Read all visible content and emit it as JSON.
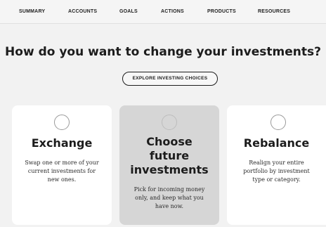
{
  "nav": {
    "items": [
      "SUMMARY",
      "ACCOUNTS",
      "GOALS",
      "ACTIONS",
      "PRODUCTS",
      "RESOURCES"
    ]
  },
  "main": {
    "headline": "How do you want to change your investments?",
    "explore_label": "EXPLORE INVESTING CHOICES"
  },
  "cards": [
    {
      "title": "Exchange",
      "desc_lines": [
        "Swap one or more of your",
        "current investments for",
        "new ones."
      ],
      "selected": false
    },
    {
      "title_lines": [
        "Choose",
        "future",
        "investments"
      ],
      "desc_lines": [
        "Pick for incoming money",
        "only, and keep what you",
        "have now."
      ],
      "selected": true
    },
    {
      "title": "Rebalance",
      "desc_lines": [
        "Realign your entire",
        "portfolio by investment",
        "type or category."
      ],
      "selected": false
    }
  ]
}
